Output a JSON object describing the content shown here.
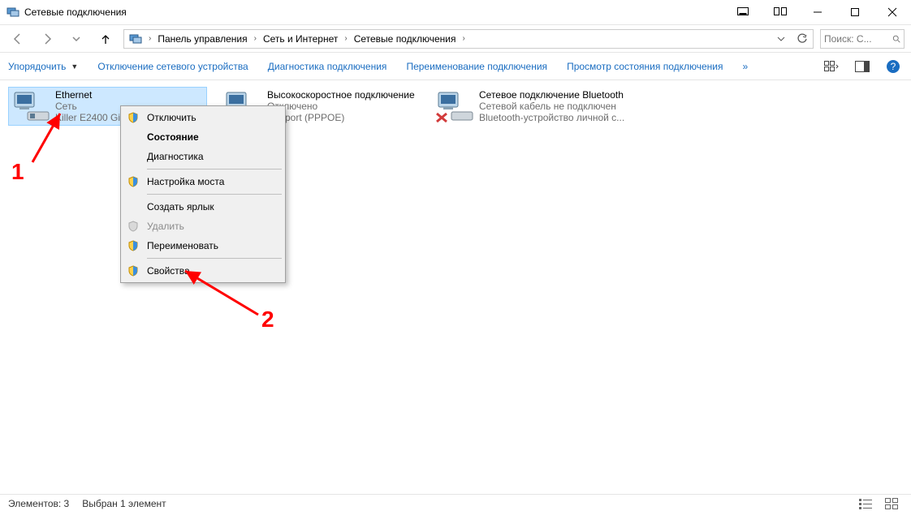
{
  "window": {
    "title": "Сетевые подключения"
  },
  "breadcrumb": {
    "items": [
      "Панель управления",
      "Сеть и Интернет",
      "Сетевые подключения"
    ]
  },
  "search": {
    "placeholder": "Поиск: С..."
  },
  "toolbar": {
    "organize": "Упорядочить",
    "disable": "Отключение сетевого устройства",
    "diagnose": "Диагностика подключения",
    "rename": "Переименование подключения",
    "status": "Просмотр состояния подключения",
    "more_glyph": "»"
  },
  "connections": [
    {
      "name": "Ethernet",
      "status": "Сеть",
      "device": "Killer E2400 Gi...",
      "state": "selected"
    },
    {
      "name": "Высокоскоростное подключение",
      "status": "Отключено",
      "device": "Miniport (PPPOE)",
      "state": "check"
    },
    {
      "name": "Сетевое подключение Bluetooth",
      "status": "Сетевой кабель не подключен",
      "device": "Bluetooth-устройство личной с...",
      "state": "cross"
    }
  ],
  "context_menu": {
    "disconnect": "Отключить",
    "status": "Состояние",
    "diagnose": "Диагностика",
    "bridge": "Настройка моста",
    "shortcut": "Создать ярлык",
    "delete": "Удалить",
    "rename": "Переименовать",
    "properties": "Свойства"
  },
  "statusbar": {
    "count": "Элементов: 3",
    "selected": "Выбран 1 элемент"
  },
  "annotations": {
    "one": "1",
    "two": "2"
  }
}
